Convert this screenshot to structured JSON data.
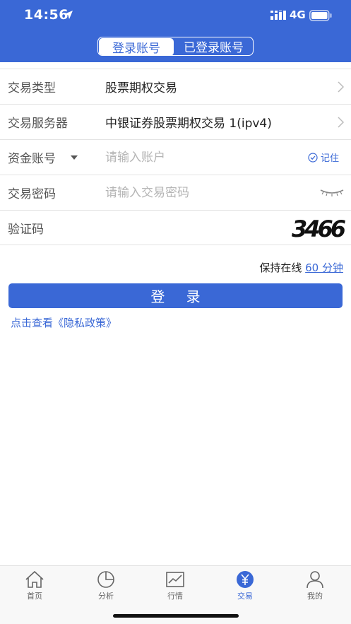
{
  "status_bar": {
    "time": "14:56",
    "network": "4G"
  },
  "segment": {
    "tabs": [
      {
        "label": "登录账号",
        "active": true
      },
      {
        "label": "已登录账号",
        "active": false
      }
    ]
  },
  "form": {
    "trade_type": {
      "label": "交易类型",
      "value": "股票期权交易"
    },
    "trade_server": {
      "label": "交易服务器",
      "value": "中银证券股票期权交易 1(ipv4)"
    },
    "account": {
      "label": "资金账号",
      "placeholder": "请输入账户",
      "remember_label": "记住"
    },
    "password": {
      "label": "交易密码",
      "placeholder": "请输入交易密码"
    },
    "captcha": {
      "label": "验证码",
      "code": "3466"
    }
  },
  "keep_online": {
    "prefix": "保持在线",
    "duration": "60 分钟"
  },
  "login_button": "登 录",
  "privacy_link": "点击查看《隐私政策》",
  "tabbar": {
    "items": [
      {
        "label": "首页",
        "icon": "home-icon"
      },
      {
        "label": "分析",
        "icon": "pie-chart-icon"
      },
      {
        "label": "行情",
        "icon": "line-chart-icon"
      },
      {
        "label": "交易",
        "icon": "yen-icon",
        "active": true
      },
      {
        "label": "我的",
        "icon": "user-icon"
      }
    ]
  },
  "colors": {
    "accent": "#3a68d6",
    "header_bg": "#3a68d6",
    "placeholder": "#b5b5b5"
  }
}
